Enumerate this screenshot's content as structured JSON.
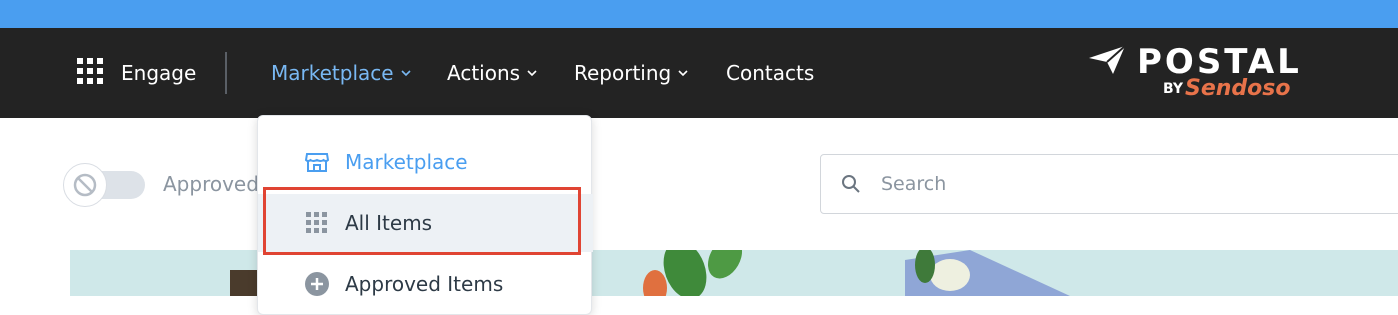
{
  "nav": {
    "app_label": "Engage",
    "items": [
      {
        "label": "Marketplace",
        "has_dropdown": true,
        "active": true
      },
      {
        "label": "Actions",
        "has_dropdown": true,
        "active": false
      },
      {
        "label": "Reporting",
        "has_dropdown": true,
        "active": false
      },
      {
        "label": "Contacts",
        "has_dropdown": false,
        "active": false
      }
    ],
    "logo": {
      "word": "POSTAL",
      "by": "BY",
      "brand": "Sendoso"
    }
  },
  "filters": {
    "approved_toggle_label": "Approved",
    "approved_toggle_on": false
  },
  "search": {
    "placeholder": "Search",
    "value": ""
  },
  "dropdown": {
    "items": [
      {
        "label": "Marketplace",
        "icon": "storefront-icon",
        "state": "header"
      },
      {
        "label": "All Items",
        "icon": "grid-dots-icon",
        "state": "selected"
      },
      {
        "label": "Approved Items",
        "icon": "plus-circle-icon",
        "state": "normal"
      }
    ]
  },
  "colors": {
    "top_strip": "#4a9ef0",
    "navbar": "#232323",
    "active_nav": "#79b8f3",
    "brand_orange": "#e8734a",
    "highlight": "#e04433"
  }
}
